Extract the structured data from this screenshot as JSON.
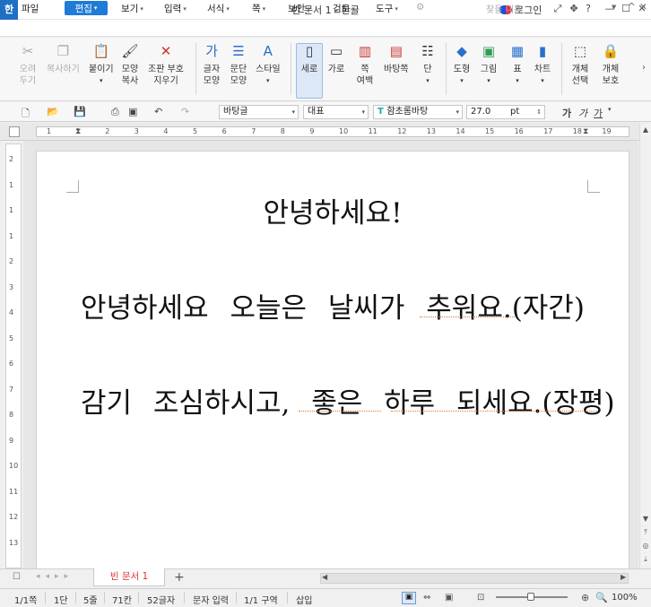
{
  "app": {
    "title": "빈 문서 1 - 한글",
    "logo": "한",
    "login": "로그인"
  },
  "menu": {
    "items": [
      "파일",
      "편집",
      "보기",
      "입력",
      "서식",
      "쪽",
      "보안",
      "검토",
      "도구"
    ],
    "search_placeholder": "찾을 내용"
  },
  "ribbon": {
    "cut_line1": "오려",
    "cut_line2": "두기",
    "copy_label": "복사하기",
    "paste_label": "붙이기",
    "shape_copy_line1": "모양",
    "shape_copy_line2": "복사",
    "clear_line1": "조판 부호",
    "clear_line2": "지우기",
    "char_shape_line1": "글자",
    "char_shape_line2": "모양",
    "para_shape_line1": "문단",
    "para_shape_line2": "모양",
    "style_label": "스타일",
    "portrait_label": "세로",
    "landscape_label": "가로",
    "margin_line1": "쪽",
    "margin_line2": "여백",
    "background_label": "바탕쪽",
    "column_label": "단",
    "shape_label": "도형",
    "image_label": "그림",
    "table_label": "표",
    "chart_label": "차트",
    "object_select_line1": "개체",
    "object_select_line2": "선택",
    "object_protect_line1": "개체",
    "object_protect_line2": "보호"
  },
  "format": {
    "style": "바탕글",
    "language": "대표",
    "font": "함초롬바탕",
    "size": "27.0",
    "unit": "pt",
    "bold": "가",
    "italic": "가",
    "underline": "가"
  },
  "ruler": {
    "numbers": [
      "1",
      "1",
      "2",
      "3",
      "4",
      "5",
      "6",
      "7",
      "8",
      "9",
      "10",
      "11",
      "12",
      "13",
      "14",
      "15",
      "16",
      "17",
      "18",
      "19"
    ]
  },
  "vruler": {
    "numbers": [
      "2",
      "1",
      "1",
      "1",
      "2",
      "3",
      "4",
      "5",
      "6",
      "7",
      "8",
      "9",
      "10",
      "11",
      "12",
      "13"
    ]
  },
  "document": {
    "line1": "안녕하세요!",
    "line2": "안녕하세요 오늘은 날씨가 추워요.(자간)",
    "line3": "감기 조심하시고, 좋은 하루 되세요.(장평)"
  },
  "tabs": {
    "doc_tab": "빈 문서 1",
    "add": "+"
  },
  "status": {
    "page": "1/1쪽",
    "column": "1단",
    "line": "5줄",
    "col": "71칸",
    "chars": "52글자",
    "mode": "문자 입력",
    "section": "1/1 구역",
    "insert": "삽입",
    "zoom": "100%"
  },
  "colors": {
    "accent": "#1f7bd6",
    "tab_text": "#d33333",
    "squiggle": "#e07a2e"
  }
}
